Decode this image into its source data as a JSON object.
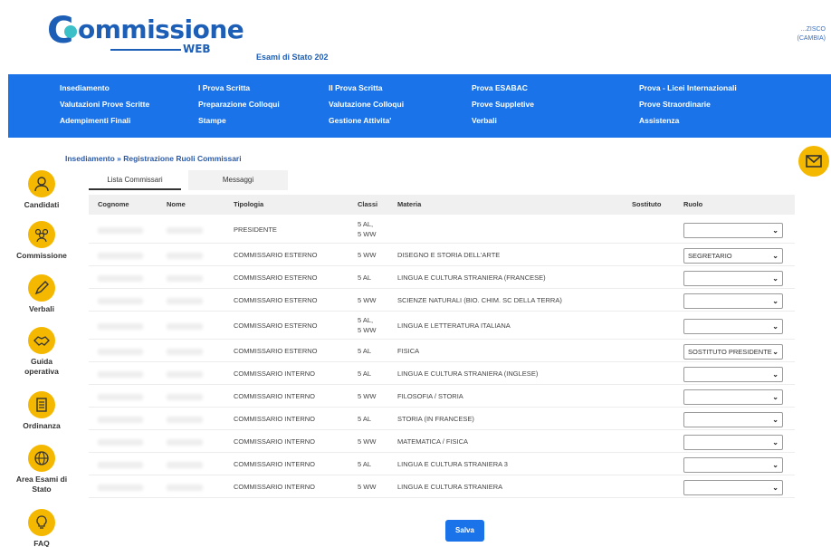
{
  "header": {
    "logo_text": "ommissione",
    "logo_initial": "C",
    "logo_web": "WEB",
    "subtitle": "Esami di Stato 202",
    "user_name": "...ZISCO",
    "user_change": "(CAMBIA)"
  },
  "nav": {
    "items": [
      "Insediamento",
      "I Prova Scritta",
      "II Prova Scritta",
      "Prova ESABAC",
      "Prova - Licei Internazionali",
      "Valutazioni Prove Scritte",
      "Preparazione Colloqui",
      "Valutazione Colloqui",
      "Prove Suppletive",
      "Prove Straordinarie",
      "Adempimenti Finali",
      "Stampe",
      "Gestione Attivita'",
      "Verbali",
      "Assistenza"
    ]
  },
  "breadcrumb": "Insediamento » Registrazione Ruoli Commissari",
  "sidebar": {
    "items": [
      {
        "label": "Candidati",
        "icon": "candidates-icon"
      },
      {
        "label": "Commissione",
        "icon": "commission-icon"
      },
      {
        "label": "Verbali",
        "icon": "pencil-icon"
      },
      {
        "label": "Guida operativa",
        "icon": "handshake-icon"
      },
      {
        "label": "Ordinanza",
        "icon": "document-icon"
      },
      {
        "label": "Area Esami di Stato",
        "icon": "globe-icon"
      },
      {
        "label": "FAQ",
        "icon": "lightbulb-icon"
      }
    ]
  },
  "tabs": [
    {
      "label": "Lista Commissari",
      "active": true
    },
    {
      "label": "Messaggi",
      "active": false
    }
  ],
  "table": {
    "headers": [
      "Cognome",
      "Nome",
      "Tipologia",
      "Classi",
      "Materia",
      "Sostituto",
      "Ruolo"
    ],
    "rows": [
      {
        "tipologia": "PRESIDENTE",
        "classi": [
          "5 AL,",
          "5 WW"
        ],
        "materia": "",
        "ruolo": ""
      },
      {
        "tipologia": "COMMISSARIO ESTERNO",
        "classi": [
          "5 WW"
        ],
        "materia": "DISEGNO E STORIA DELL'ARTE",
        "ruolo": "SEGRETARIO"
      },
      {
        "tipologia": "COMMISSARIO ESTERNO",
        "classi": [
          "5 AL"
        ],
        "materia": "LINGUA E CULTURA STRANIERA (FRANCESE)",
        "ruolo": ""
      },
      {
        "tipologia": "COMMISSARIO ESTERNO",
        "classi": [
          "5 WW"
        ],
        "materia": "SCIENZE NATURALI (BIO. CHIM. SC DELLA TERRA)",
        "ruolo": ""
      },
      {
        "tipologia": "COMMISSARIO ESTERNO",
        "classi": [
          "5 AL,",
          "5 WW"
        ],
        "materia": "LINGUA E LETTERATURA ITALIANA",
        "ruolo": ""
      },
      {
        "tipologia": "COMMISSARIO ESTERNO",
        "classi": [
          "5 AL"
        ],
        "materia": "FISICA",
        "ruolo": "SOSTITUTO PRESIDENTE"
      },
      {
        "tipologia": "COMMISSARIO INTERNO",
        "classi": [
          "5 AL"
        ],
        "materia": "LINGUA E CULTURA STRANIERA (INGLESE)",
        "ruolo": ""
      },
      {
        "tipologia": "COMMISSARIO INTERNO",
        "classi": [
          "5 WW"
        ],
        "materia": "FILOSOFIA / STORIA",
        "ruolo": ""
      },
      {
        "tipologia": "COMMISSARIO INTERNO",
        "classi": [
          "5 AL"
        ],
        "materia": "STORIA (IN FRANCESE)",
        "ruolo": ""
      },
      {
        "tipologia": "COMMISSARIO INTERNO",
        "classi": [
          "5 WW"
        ],
        "materia": "MATEMATICA / FISICA",
        "ruolo": ""
      },
      {
        "tipologia": "COMMISSARIO INTERNO",
        "classi": [
          "5 AL"
        ],
        "materia": "LINGUA E CULTURA STRANIERA 3",
        "ruolo": ""
      },
      {
        "tipologia": "COMMISSARIO INTERNO",
        "classi": [
          "5 WW"
        ],
        "materia": "LINGUA E CULTURA STRANIERA",
        "ruolo": ""
      }
    ]
  },
  "save_label": "Salva",
  "colors": {
    "accent": "#1a73e8",
    "brand": "#1d5fb6",
    "icon_bg": "#f5b800",
    "logo_dot": "#3cc0c8"
  }
}
